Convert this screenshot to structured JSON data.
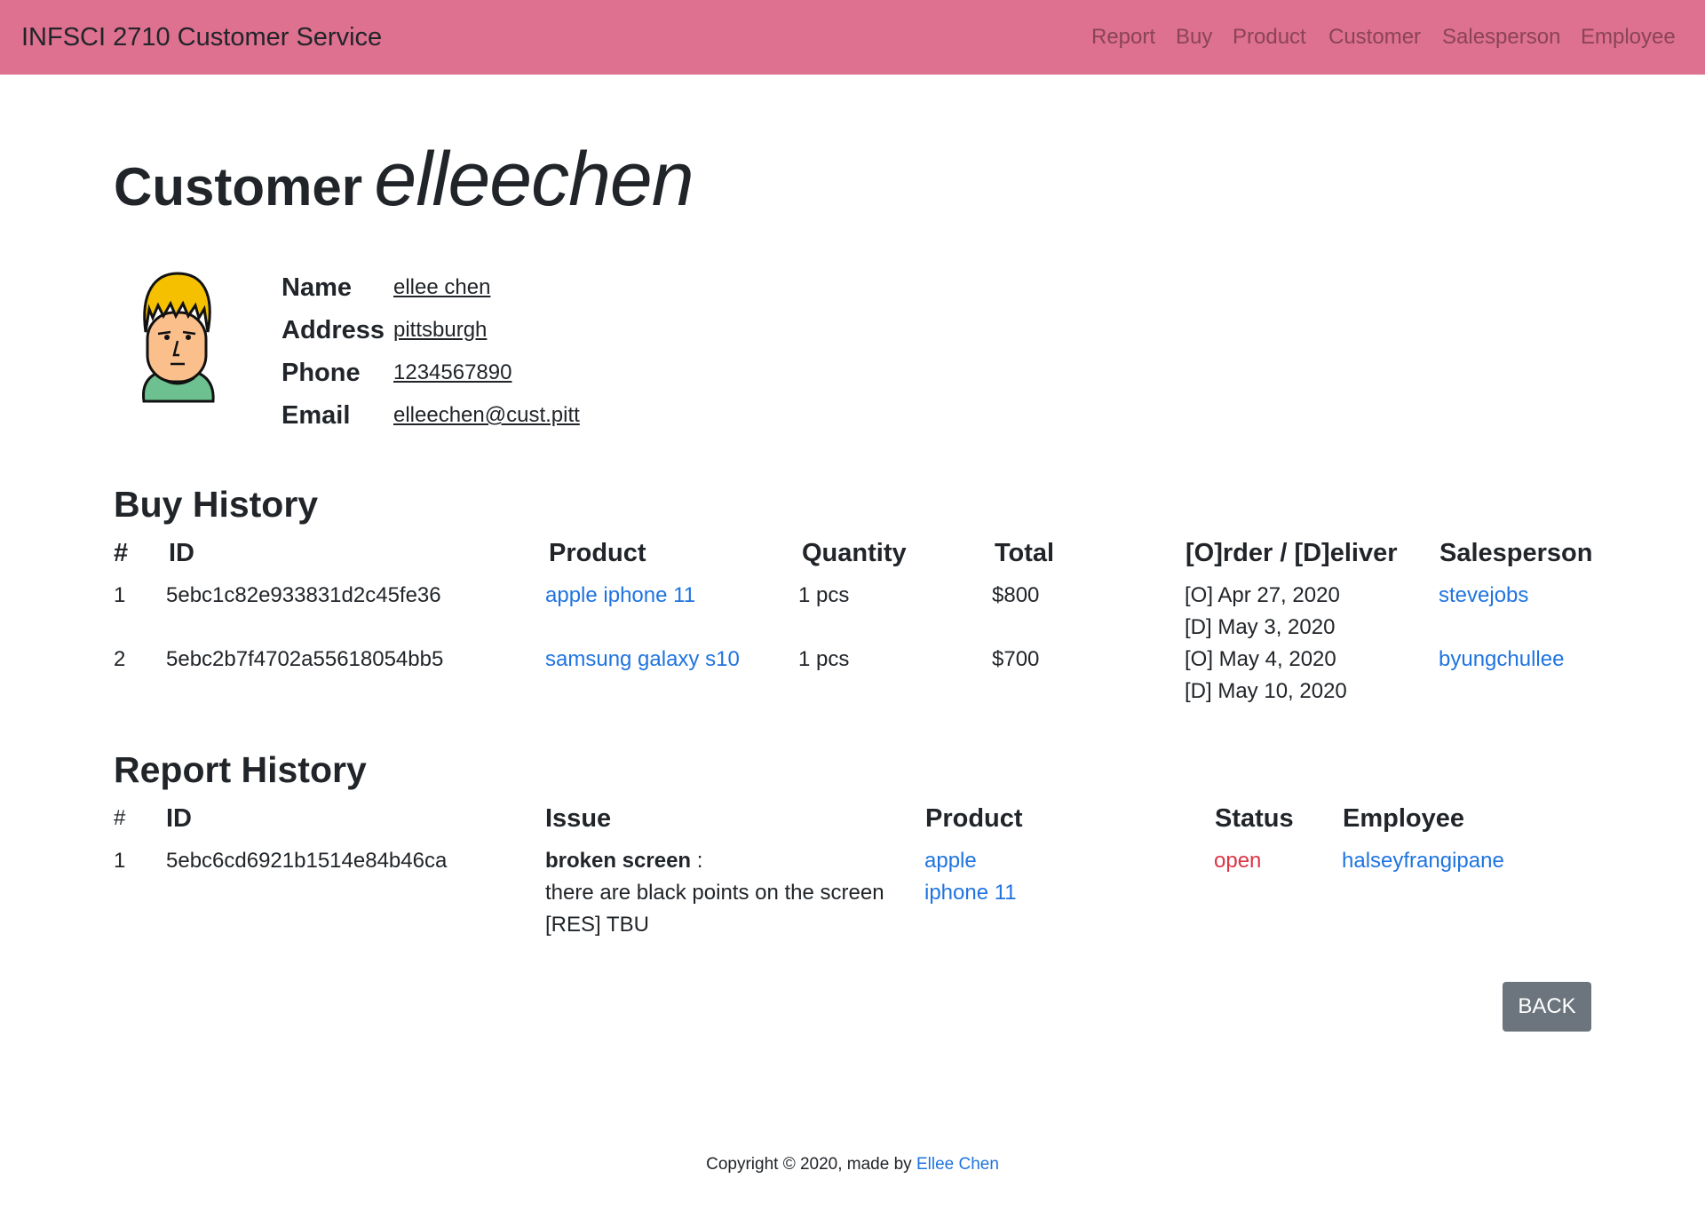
{
  "navbar": {
    "brand": "INFSCI 2710 Customer Service",
    "links": [
      "Report",
      "Buy",
      "Product",
      "Customer",
      "Salesperson",
      "Employee"
    ]
  },
  "page_title": {
    "label": "Customer",
    "username": "elleechen"
  },
  "avatar": {
    "icon": "person-avatar-icon"
  },
  "customer_info": [
    {
      "label": "Name",
      "value": "ellee chen"
    },
    {
      "label": "Address",
      "value": "pittsburgh"
    },
    {
      "label": "Phone",
      "value": "1234567890"
    },
    {
      "label": "Email",
      "value": "elleechen@cust.pitt"
    }
  ],
  "buy_history": {
    "title": "Buy History",
    "columns": [
      "#",
      "ID",
      "Product",
      "Quantity",
      "Total",
      "[O]rder / [D]eliver",
      "Salesperson"
    ],
    "rows": [
      {
        "num": "1",
        "id": "5ebc1c82e933831d2c45fe36",
        "product": "apple iphone 11",
        "quantity": "1 pcs",
        "total": "$800",
        "order": "[O] Apr 27, 2020",
        "deliver": "[D] May 3, 2020",
        "salesperson": "stevejobs"
      },
      {
        "num": "2",
        "id": "5ebc2b7f4702a55618054bb5",
        "product": "samsung galaxy s10",
        "quantity": "1 pcs",
        "total": "$700",
        "order": "[O] May 4, 2020",
        "deliver": "[D] May 10, 2020",
        "salesperson": "byungchullee"
      }
    ]
  },
  "report_history": {
    "title": "Report History",
    "columns": [
      "#",
      "ID",
      "Issue",
      "Product",
      "Status",
      "Employee"
    ],
    "rows": [
      {
        "num": "1",
        "id": "5ebc6cd6921b1514e84b46ca",
        "issue_title": "broken screen",
        "issue_sep": " :",
        "issue_detail": "there are black points on the screen",
        "resolution": "[RES] TBU",
        "product_line1": "apple",
        "product_line2": "iphone 11",
        "status": "open",
        "employee": "halseyfrangipane"
      }
    ]
  },
  "back_button": "BACK",
  "footer": {
    "text": "Copyright © 2020, made by ",
    "author": "Ellee Chen"
  },
  "colors": {
    "navbar": "#de7090",
    "link": "#1f74e0",
    "status_open": "#dc3545",
    "button": "#6c757d"
  }
}
